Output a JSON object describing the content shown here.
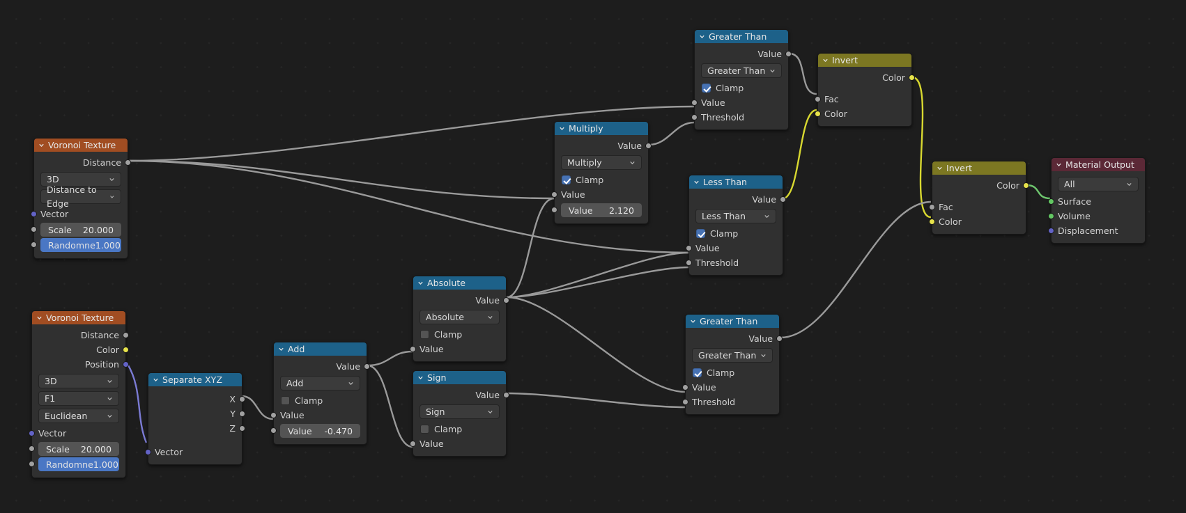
{
  "app": {
    "name": "blender-shader-node-editor",
    "background_color": "#1d1d1d"
  },
  "colors": {
    "header_blue": "#1d6189",
    "header_orange": "#a14d22",
    "header_olive": "#7c7722",
    "header_maroon": "#5b2836",
    "socket_gray": "#a1a1a1",
    "socket_yellow": "#e7e34b",
    "socket_purple": "#6363c7",
    "socket_green": "#63c763",
    "wire_gray": "#9a9a9a",
    "wire_yellow": "#d8d830",
    "wire_purple": "#7b7bd4",
    "wire_green": "#6fc76f",
    "checkbox_on": "#4772b3",
    "value_slider_blue": "#4a77c4"
  },
  "nodes": [
    {
      "id": "voronoi1",
      "title": "Voronoi Texture",
      "header_style": "orange",
      "outputs": [
        {
          "label": "Distance",
          "socket": "gray"
        }
      ],
      "dropdowns": [
        "3D",
        "Distance to Edge"
      ],
      "inputs": [
        {
          "label": "Vector",
          "socket": "purple"
        }
      ],
      "fields": [
        {
          "label": "Scale",
          "value": "20.000",
          "socket": "gray",
          "style": "gray"
        },
        {
          "label": "Randomne",
          "value": "1.000",
          "socket": "gray",
          "style": "blue"
        }
      ]
    },
    {
      "id": "voronoi2",
      "title": "Voronoi Texture",
      "header_style": "orange",
      "outputs": [
        {
          "label": "Distance",
          "socket": "gray"
        },
        {
          "label": "Color",
          "socket": "yellow"
        },
        {
          "label": "Position",
          "socket": "purple"
        }
      ],
      "dropdowns": [
        "3D",
        "F1",
        "Euclidean"
      ],
      "inputs": [
        {
          "label": "Vector",
          "socket": "purple"
        }
      ],
      "fields": [
        {
          "label": "Scale",
          "value": "20.000",
          "socket": "gray",
          "style": "gray"
        },
        {
          "label": "Randomne",
          "value": "1.000",
          "socket": "gray",
          "style": "blue"
        }
      ]
    },
    {
      "id": "separate_xyz",
      "title": "Separate XYZ",
      "header_style": "blue",
      "outputs": [
        {
          "label": "X",
          "socket": "gray"
        },
        {
          "label": "Y",
          "socket": "gray"
        },
        {
          "label": "Z",
          "socket": "gray"
        }
      ],
      "dropdowns": [],
      "inputs": [
        {
          "label": "Vector",
          "socket": "purple"
        }
      ],
      "fields": []
    },
    {
      "id": "add",
      "title": "Add",
      "header_style": "blue",
      "outputs": [
        {
          "label": "Value",
          "socket": "gray"
        }
      ],
      "dropdowns": [
        "Add"
      ],
      "checkbox": {
        "label": "Clamp",
        "checked": false
      },
      "inputs": [
        {
          "label": "Value",
          "socket": "gray"
        }
      ],
      "fields": [
        {
          "label": "Value",
          "value": "-0.470",
          "socket": "gray",
          "style": "gray"
        }
      ]
    },
    {
      "id": "absolute",
      "title": "Absolute",
      "header_style": "blue",
      "outputs": [
        {
          "label": "Value",
          "socket": "gray"
        }
      ],
      "dropdowns": [
        "Absolute"
      ],
      "checkbox": {
        "label": "Clamp",
        "checked": false
      },
      "inputs": [
        {
          "label": "Value",
          "socket": "gray"
        }
      ],
      "fields": []
    },
    {
      "id": "sign",
      "title": "Sign",
      "header_style": "blue",
      "outputs": [
        {
          "label": "Value",
          "socket": "gray"
        }
      ],
      "dropdowns": [
        "Sign"
      ],
      "checkbox": {
        "label": "Clamp",
        "checked": false
      },
      "inputs": [
        {
          "label": "Value",
          "socket": "gray"
        }
      ],
      "fields": []
    },
    {
      "id": "multiply",
      "title": "Multiply",
      "header_style": "blue",
      "outputs": [
        {
          "label": "Value",
          "socket": "gray"
        }
      ],
      "dropdowns": [
        "Multiply"
      ],
      "checkbox": {
        "label": "Clamp",
        "checked": true
      },
      "inputs": [
        {
          "label": "Value",
          "socket": "gray"
        }
      ],
      "fields": [
        {
          "label": "Value",
          "value": "2.120",
          "socket": "gray",
          "style": "gray"
        }
      ]
    },
    {
      "id": "greater_than_1",
      "title": "Greater Than",
      "header_style": "blue",
      "outputs": [
        {
          "label": "Value",
          "socket": "gray"
        }
      ],
      "dropdowns": [
        "Greater Than"
      ],
      "checkbox": {
        "label": "Clamp",
        "checked": true
      },
      "inputs": [
        {
          "label": "Value",
          "socket": "gray"
        },
        {
          "label": "Threshold",
          "socket": "gray"
        }
      ],
      "fields": []
    },
    {
      "id": "less_than",
      "title": "Less Than",
      "header_style": "blue",
      "outputs": [
        {
          "label": "Value",
          "socket": "gray"
        }
      ],
      "dropdowns": [
        "Less Than"
      ],
      "checkbox": {
        "label": "Clamp",
        "checked": true
      },
      "inputs": [
        {
          "label": "Value",
          "socket": "gray"
        },
        {
          "label": "Threshold",
          "socket": "gray"
        }
      ],
      "fields": []
    },
    {
      "id": "greater_than_2",
      "title": "Greater Than",
      "header_style": "blue",
      "outputs": [
        {
          "label": "Value",
          "socket": "gray"
        }
      ],
      "dropdowns": [
        "Greater Than"
      ],
      "checkbox": {
        "label": "Clamp",
        "checked": true
      },
      "inputs": [
        {
          "label": "Value",
          "socket": "gray"
        },
        {
          "label": "Threshold",
          "socket": "gray"
        }
      ],
      "fields": []
    },
    {
      "id": "invert1",
      "title": "Invert",
      "header_style": "olive",
      "outputs": [
        {
          "label": "Color",
          "socket": "yellow"
        }
      ],
      "dropdowns": [],
      "inputs": [
        {
          "label": "Fac",
          "socket": "gray"
        },
        {
          "label": "Color",
          "socket": "yellow"
        }
      ],
      "fields": []
    },
    {
      "id": "invert2",
      "title": "Invert",
      "header_style": "olive",
      "outputs": [
        {
          "label": "Color",
          "socket": "yellow"
        }
      ],
      "dropdowns": [],
      "inputs": [
        {
          "label": "Fac",
          "socket": "gray"
        },
        {
          "label": "Color",
          "socket": "yellow"
        }
      ],
      "fields": []
    },
    {
      "id": "material_output",
      "title": "Material Output",
      "header_style": "maroon",
      "outputs": [],
      "dropdowns": [
        "All"
      ],
      "inputs": [
        {
          "label": "Surface",
          "socket": "green"
        },
        {
          "label": "Volume",
          "socket": "green"
        },
        {
          "label": "Displacement",
          "socket": "purple"
        }
      ],
      "fields": []
    }
  ]
}
